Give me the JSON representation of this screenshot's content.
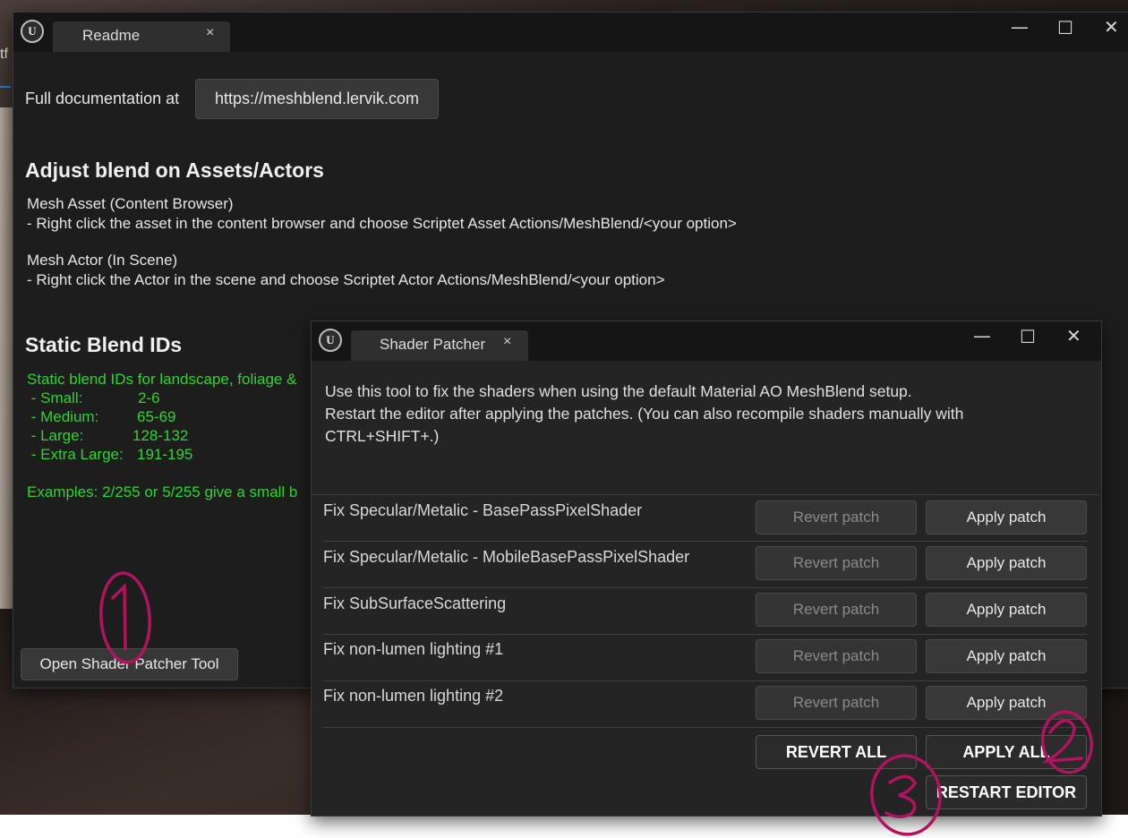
{
  "background": {
    "partial_text": "tf"
  },
  "readme_window": {
    "logo": "U",
    "tab_label": "Readme",
    "tab_close": "×",
    "controls": {
      "minimize": "—",
      "maximize": "☐",
      "close": "✕"
    },
    "doc_label": "Full documentation at",
    "doc_link": "https://meshblend.lervik.com",
    "section1_heading": "Adjust blend on Assets/Actors",
    "asset_title": "Mesh Asset (Content Browser)",
    "asset_desc": "- Right click the asset in the content browser and choose Scriptet Asset Actions/MeshBlend/<your option>",
    "actor_title": "Mesh Actor (In Scene)",
    "actor_desc": "- Right click the Actor in the scene and choose Scriptet Actor Actions/MeshBlend/<your option>",
    "section2_heading": "Static Blend IDs",
    "static_intro": "Static blend IDs for landscape, foliage &",
    "static_ids": [
      {
        "name": " - Small:",
        "range": "2-6"
      },
      {
        "name": " - Medium:",
        "range": "65-69"
      },
      {
        "name": " - Large:",
        "range": "128-132"
      },
      {
        "name": " - Extra Large:",
        "range": "191-195"
      }
    ],
    "examples": "Examples: 2/255 or 5/255 give a small b",
    "open_tool_button": "Open Shader Patcher Tool"
  },
  "shader_patcher": {
    "logo": "U",
    "tab_label": "Shader Patcher",
    "tab_close": "×",
    "controls": {
      "minimize": "—",
      "maximize": "☐",
      "close": "✕"
    },
    "description_line1": "Use this tool to fix the shaders when using the default Material AO MeshBlend setup.",
    "description_line2": "Restart the editor after applying the patches. (You can also recompile shaders manually with",
    "description_line3": "CTRL+SHIFT+.)",
    "patches": [
      {
        "label": "Fix Specular/Metalic - BasePassPixelShader",
        "revert": "Revert patch",
        "apply": "Apply patch"
      },
      {
        "label": "Fix Specular/Metalic - MobileBasePassPixelShader",
        "revert": "Revert patch",
        "apply": "Apply patch"
      },
      {
        "label": "Fix SubSurfaceScattering",
        "revert": "Revert patch",
        "apply": "Apply patch"
      },
      {
        "label": "Fix non-lumen lighting #1",
        "revert": "Revert patch",
        "apply": "Apply patch"
      },
      {
        "label": "Fix non-lumen lighting #2",
        "revert": "Revert patch",
        "apply": "Apply patch"
      }
    ],
    "revert_all": "REVERT ALL",
    "apply_all": "APPLY ALL",
    "restart_editor": "RESTART EDITOR"
  },
  "annotations": {
    "color": "#b0145e",
    "marks": [
      "1",
      "2",
      "3"
    ]
  }
}
